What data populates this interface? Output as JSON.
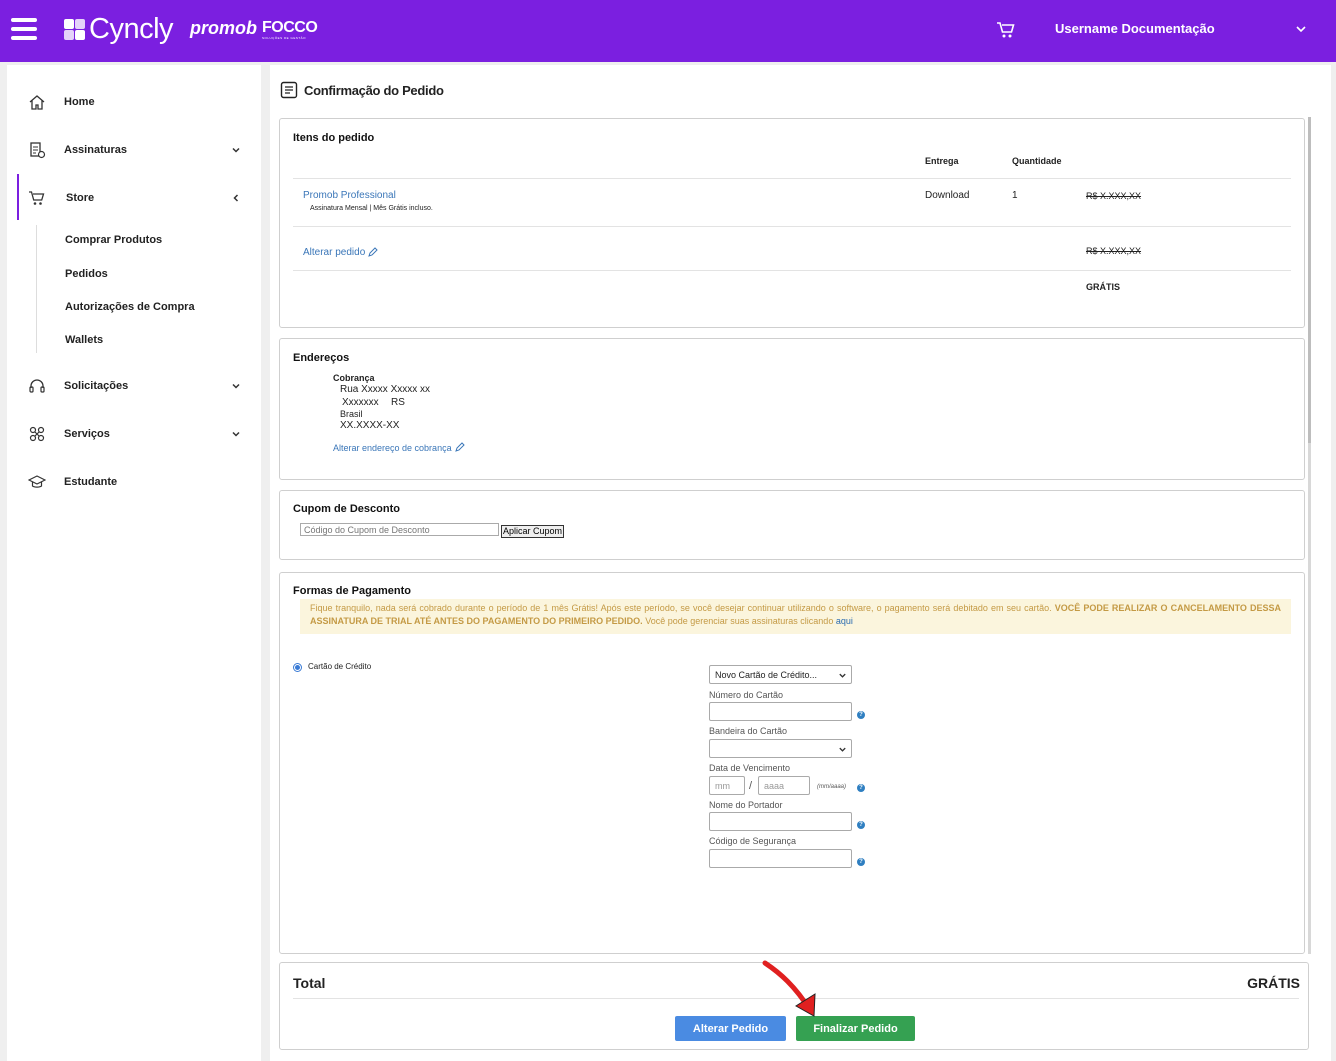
{
  "header": {
    "brand": "Cyncly",
    "brand_promob": "promob",
    "brand_focco": "FOCCO",
    "brand_focco_tagline": "SOLUÇÕES DE GESTÃO",
    "username": "Username Documentação",
    "bar_color": "#7b1fe0"
  },
  "sidebar": {
    "items": [
      {
        "label": "Home",
        "icon": "home-icon"
      },
      {
        "label": "Assinaturas",
        "icon": "subscriptions-icon"
      },
      {
        "label": "Store",
        "icon": "cart-icon"
      },
      {
        "label": "Solicitações",
        "icon": "headset-icon"
      },
      {
        "label": "Serviços",
        "icon": "services-icon"
      },
      {
        "label": "Estudante",
        "icon": "graduation-cap-icon"
      }
    ],
    "store_sub": [
      "Comprar Produtos",
      "Pedidos",
      "Autorizações de Compra",
      "Wallets"
    ]
  },
  "page": {
    "title": "Confirmação do Pedido"
  },
  "order": {
    "title": "Itens do pedido",
    "col_entrega": "Entrega",
    "col_quantidade": "Quantidade",
    "item_name": "Promob Professional",
    "item_desc": "Assinatura Mensal | Mês Grátis incluso.",
    "item_delivery": "Download",
    "item_qty": "1",
    "item_price": "R$ X.XXX,XX",
    "alter_link": "Alterar pedido",
    "subtotal": "R$ X.XXX,XX",
    "total_free": "GRÁTIS"
  },
  "address": {
    "title": "Endereços",
    "label": "Cobrança",
    "line1": "Rua Xxxxx Xxxxx xx",
    "line2": "Xxxxxxx",
    "state": "RS",
    "country": "Brasil",
    "zip": "XX.XXXX-XX",
    "alter_link": "Alterar endereço de cobrança"
  },
  "coupon": {
    "title": "Cupom de Desconto",
    "placeholder": "Código do Cupom de Desconto",
    "button": "Aplicar Cupom"
  },
  "payment": {
    "title": "Formas de Pagamento",
    "notice_normal": "Fique tranquilo, nada será cobrado durante o período de 1 mês Grátis! Após este período, se você desejar continuar utilizando o software, o pagamento será debitado em seu cartão.",
    "notice_bold": "VOCÊ PODE REALIZAR O CANCELAMENTO DESSA ASSINATURA DE TRIAL ATÉ ANTES DO PAGAMENTO DO PRIMEIRO PEDIDO.",
    "notice_tail": "Você pode gerenciar suas assinaturas clicando",
    "notice_link": "aqui",
    "method": "Cartão de Crédito",
    "card_select": "Novo Cartão de Crédito...",
    "card_number_label": "Número do Cartão",
    "brand_label": "Bandeira do Cartão",
    "expiry_label": "Data de Vencimento",
    "mm_placeholder": "mm",
    "yyyy_placeholder": "aaaa",
    "expiry_hint": "(mm/aaaa)",
    "separator": "/",
    "holder_label": "Nome do Portador",
    "cvv_label": "Código de Segurança",
    "help": "?"
  },
  "summary": {
    "total_label": "Total",
    "total_value": "GRÁTIS",
    "alter_button": "Alterar Pedido",
    "finish_button": "Finalizar Pedido"
  }
}
